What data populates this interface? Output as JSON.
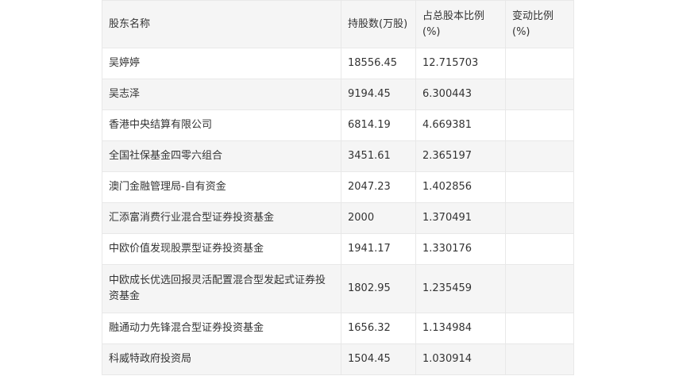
{
  "table": {
    "headers": [
      "股东名称",
      "持股数(万股)",
      "占总股本比例(%)",
      "变动比例(%)"
    ],
    "rows": [
      {
        "name": "吴婷婷",
        "shares": "18556.45",
        "ratio": "12.715703",
        "change": ""
      },
      {
        "name": "吴志泽",
        "shares": "9194.45",
        "ratio": "6.300443",
        "change": ""
      },
      {
        "name": "香港中央结算有限公司",
        "shares": "6814.19",
        "ratio": "4.669381",
        "change": ""
      },
      {
        "name": "全国社保基金四零六组合",
        "shares": "3451.61",
        "ratio": "2.365197",
        "change": ""
      },
      {
        "name": "澳门金融管理局-自有资金",
        "shares": "2047.23",
        "ratio": "1.402856",
        "change": ""
      },
      {
        "name": "汇添富消费行业混合型证券投资基金",
        "shares": "2000",
        "ratio": "1.370491",
        "change": ""
      },
      {
        "name": "中欧价值发现股票型证券投资基金",
        "shares": "1941.17",
        "ratio": "1.330176",
        "change": ""
      },
      {
        "name": "中欧成长优选回报灵活配置混合型发起式证券投资基金",
        "shares": "1802.95",
        "ratio": "1.235459",
        "change": ""
      },
      {
        "name": "融通动力先锋混合型证券投资基金",
        "shares": "1656.32",
        "ratio": "1.134984",
        "change": ""
      },
      {
        "name": "科威特政府投资局",
        "shares": "1504.45",
        "ratio": "1.030914",
        "change": ""
      }
    ]
  }
}
